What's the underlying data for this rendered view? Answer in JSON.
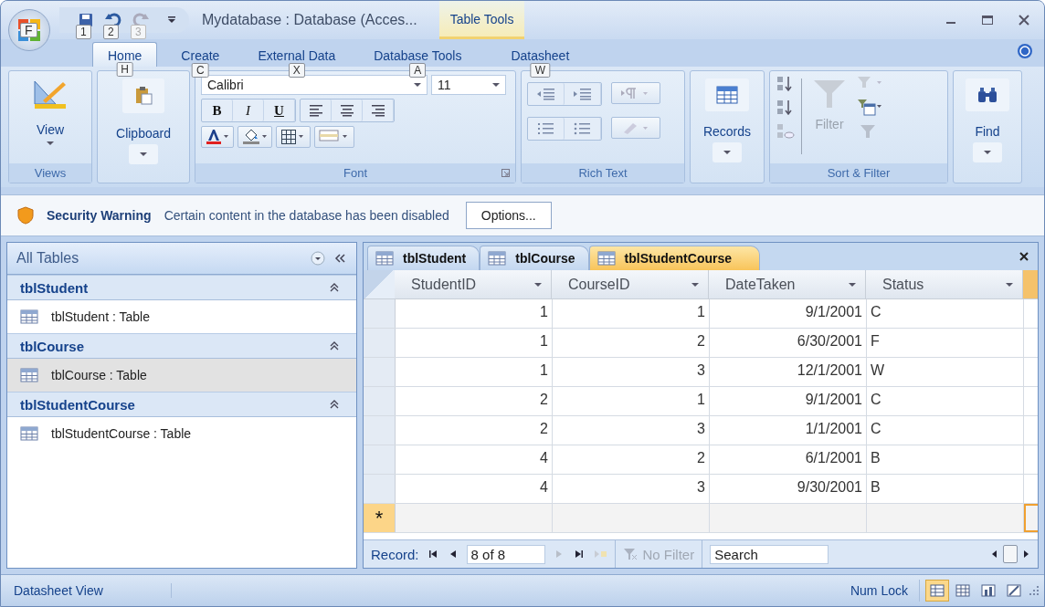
{
  "window": {
    "title": "Mydatabase : Database (Acces...",
    "context_tab": "Table Tools"
  },
  "office_button": {
    "keytip": "F"
  },
  "quick_access": [
    {
      "kind": "save",
      "keytip": "1",
      "disabled": false
    },
    {
      "kind": "undo",
      "keytip": "2",
      "disabled": false
    },
    {
      "kind": "redo",
      "keytip": "3",
      "disabled": true
    }
  ],
  "ribbon_tabs": [
    {
      "label": "Home",
      "keytip": "H",
      "selected": true
    },
    {
      "label": "Create",
      "keytip": "C",
      "selected": false
    },
    {
      "label": "External Data",
      "keytip": "X",
      "selected": false
    },
    {
      "label": "Database Tools",
      "keytip": "A",
      "selected": false
    },
    {
      "label": "Datasheet",
      "keytip": "W",
      "selected": false
    }
  ],
  "ribbon": {
    "views": {
      "button": "View",
      "group": "Views"
    },
    "clipboard": {
      "button": "Clipboard"
    },
    "font": {
      "name": "Calibri",
      "size": "11",
      "group": "Font",
      "styles": [
        {
          "label": "B",
          "kind": "bold"
        },
        {
          "label": "I",
          "kind": "italic"
        },
        {
          "label": "U",
          "kind": "underline"
        }
      ]
    },
    "rich_text": {
      "group": "Rich Text"
    },
    "records": {
      "button": "Records"
    },
    "sort_filter": {
      "group": "Sort & Filter",
      "filter": {
        "label": "Filter",
        "disabled": true
      }
    },
    "find": {
      "button": "Find"
    }
  },
  "security_bar": {
    "title": "Security Warning",
    "message": "Certain content in the database has been disabled",
    "button": "Options..."
  },
  "navigation": {
    "title": "All Tables",
    "groups": [
      {
        "name": "tblStudent",
        "items": [
          {
            "label": "tblStudent : Table",
            "selected": false
          }
        ]
      },
      {
        "name": "tblCourse",
        "items": [
          {
            "label": "tblCourse : Table",
            "selected": true
          }
        ]
      },
      {
        "name": "tblStudentCourse",
        "items": [
          {
            "label": "tblStudentCourse : Table",
            "selected": false
          }
        ]
      }
    ]
  },
  "document_tabs": [
    {
      "label": "tblStudent",
      "selected": false
    },
    {
      "label": "tblCourse",
      "selected": false
    },
    {
      "label": "tblStudentCourse",
      "selected": true
    }
  ],
  "datasheet": {
    "columns": [
      "StudentID",
      "CourseID",
      "DateTaken",
      "Status"
    ],
    "rows": [
      [
        "1",
        "1",
        "9/1/2001",
        "C"
      ],
      [
        "1",
        "2",
        "6/30/2001",
        "F"
      ],
      [
        "1",
        "3",
        "12/1/2001",
        "W"
      ],
      [
        "2",
        "1",
        "9/1/2001",
        "C"
      ],
      [
        "2",
        "3",
        "1/1/2001",
        "C"
      ],
      [
        "4",
        "2",
        "6/1/2001",
        "B"
      ],
      [
        "4",
        "3",
        "9/30/2001",
        "B"
      ]
    ],
    "new_row_marker": "*"
  },
  "record_nav": {
    "label": "Record:",
    "position": "8 of 8",
    "filter": {
      "label": "No Filter",
      "disabled": true
    },
    "search": {
      "placeholder": "Search"
    }
  },
  "status_bar": {
    "text": "Datasheet View",
    "indicator": "Num Lock"
  }
}
